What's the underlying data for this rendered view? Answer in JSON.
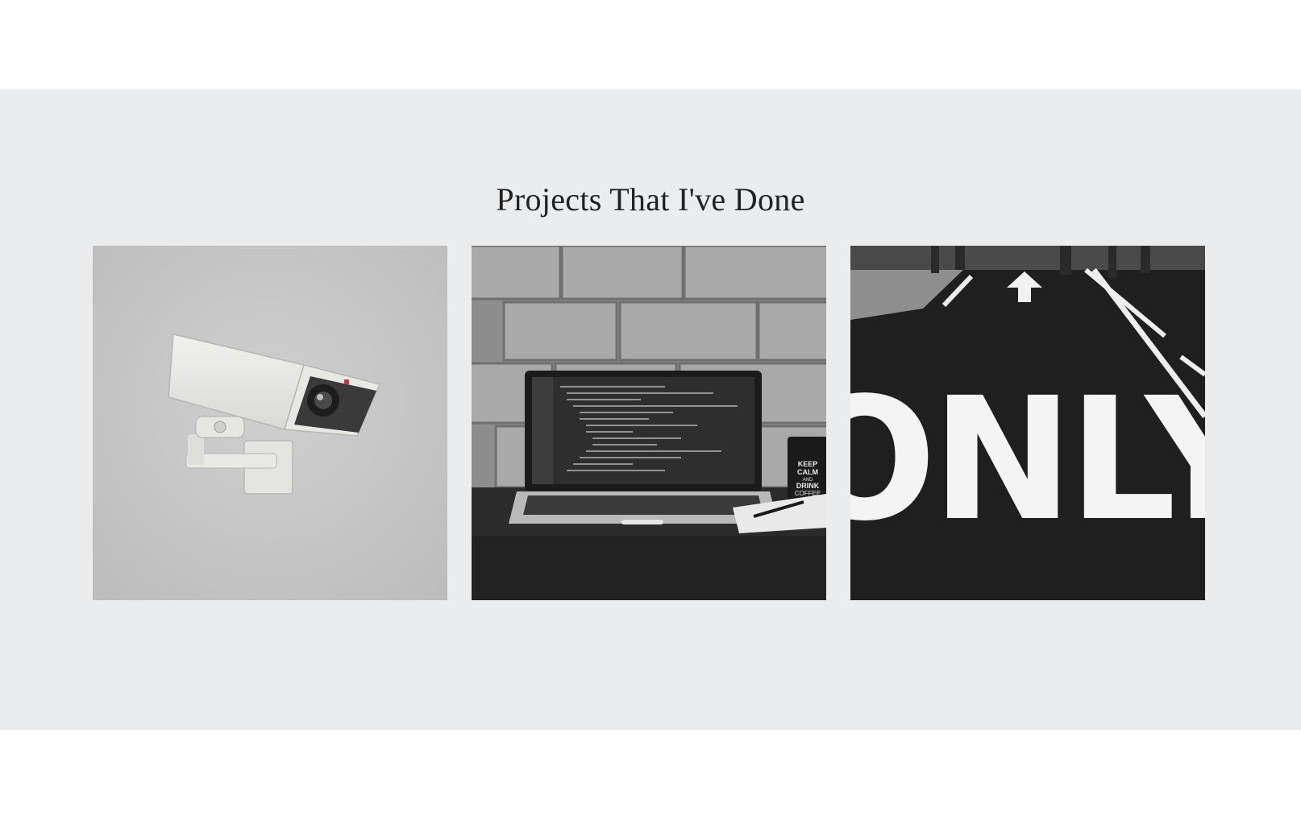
{
  "projects": {
    "title": "Projects That I've Done",
    "items": [
      {
        "icon": "security-camera-image"
      },
      {
        "icon": "laptop-code-image",
        "mug_text": [
          "KEEP",
          "CALM",
          "AND",
          "DRINK",
          "COFFEE"
        ]
      },
      {
        "icon": "road-marking-image",
        "road_text": "ONLY"
      }
    ]
  },
  "colors": {
    "section_bg": "#ebecee",
    "title": "#222222",
    "page_bg": "#ffffff"
  }
}
